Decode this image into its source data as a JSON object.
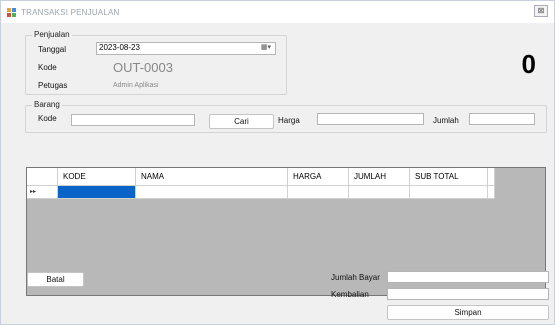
{
  "window": {
    "title": "TRANSAKSI PENJUALAN",
    "close_label": "⊠"
  },
  "penjualan": {
    "group_label": "Penjualan",
    "tanggal_label": "Tanggal",
    "tanggal_value": "2023-08-23",
    "kode_label": "Kode",
    "kode_value": "OUT-0003",
    "petugas_label": "Petugas",
    "petugas_value": "Admin Aplikasi"
  },
  "total_display": "0",
  "barang": {
    "group_label": "Barang",
    "kode_label": "Kode",
    "cari_label": "Cari",
    "harga_label": "Harga",
    "jumlah_label": "Jumlah"
  },
  "grid": {
    "columns": [
      "KODE",
      "NAMA",
      "HARGA",
      "JUMLAH",
      "SUB TOTAL"
    ],
    "row_marker": "▸▸"
  },
  "footer": {
    "batal_label": "Batal",
    "jumlah_bayar_label": "Jumlah Bayar",
    "kembalian_label": "Kembalian",
    "simpan_label": "Simpan"
  }
}
